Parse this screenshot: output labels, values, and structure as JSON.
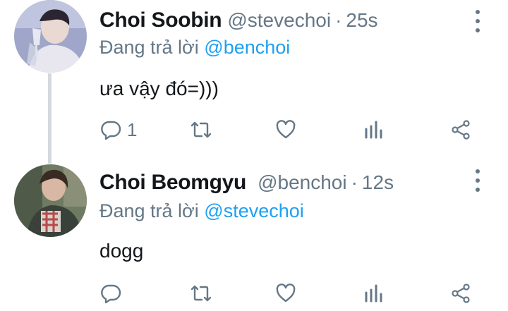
{
  "tweets": [
    {
      "name": "Choi Soobin",
      "handle": "@stevechoi",
      "separator": "·",
      "time": "25s",
      "replying_prefix": "Đang trả lời",
      "replying_to": "@benchoi",
      "text": "ưa vậy đó=)))",
      "reply_count": "1"
    },
    {
      "name": "Choi Beomgyu",
      "handle": "@benchoi",
      "separator": "·",
      "time": "12s",
      "replying_prefix": "Đang trả lời",
      "replying_to": "@stevechoi",
      "text": "dogg",
      "reply_count": ""
    }
  ],
  "icons": {
    "reply": "reply-icon",
    "retweet": "retweet-icon",
    "like": "heart-icon",
    "stats": "analytics-icon",
    "share": "share-icon",
    "more": "more-vertical-icon"
  },
  "colors": {
    "text": "#14171a",
    "secondary": "#657786",
    "link": "#1da1f2",
    "thread_line": "#d4d9de"
  }
}
